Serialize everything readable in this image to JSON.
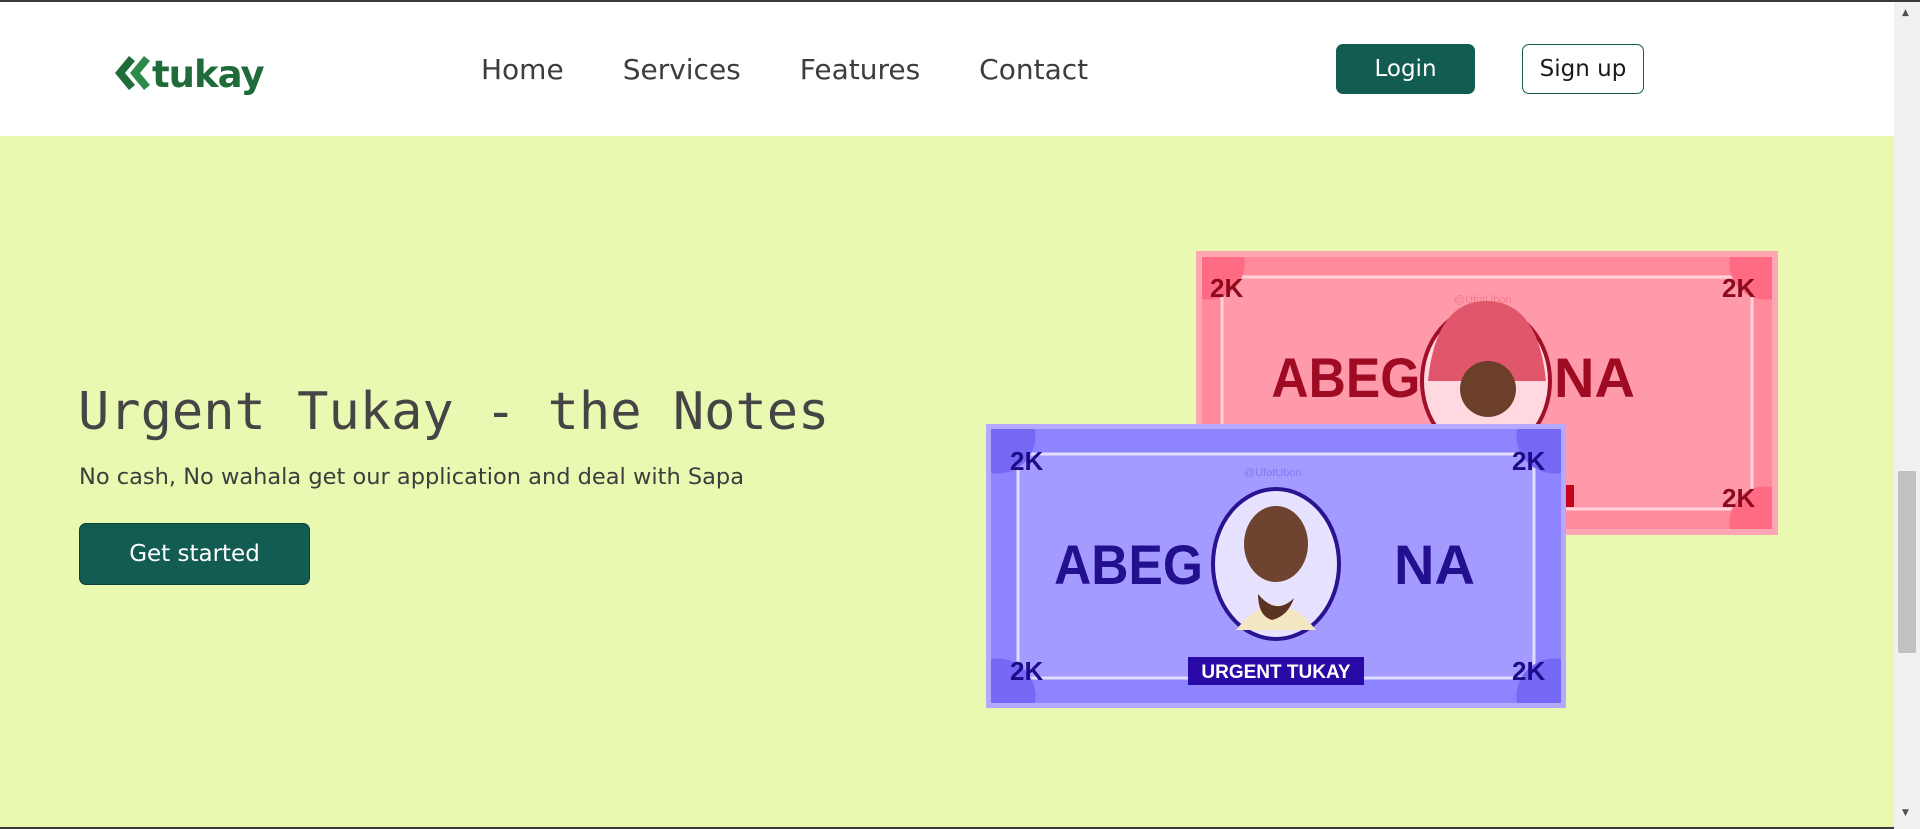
{
  "brand": {
    "logo_text": "tukay",
    "logo_color": "#1f6b3a"
  },
  "nav": {
    "links": [
      "Home",
      "Services",
      "Features",
      "Contact"
    ],
    "login_label": "Login",
    "signup_label": "Sign up"
  },
  "hero": {
    "title": "Urgent Tukay - the Notes",
    "subtitle": "No cash, No wahala get our application and deal with Sapa",
    "cta_label": "Get started"
  },
  "notes": {
    "pink": {
      "denomination": "2K",
      "left_word": "ABEG",
      "right_word": "NA",
      "watermark": "@UfotUbon",
      "color": "#ff8fa0"
    },
    "purple": {
      "denomination": "2K",
      "left_word": "ABEG",
      "right_word": "NA",
      "banner": "URGENT TUKAY",
      "watermark": "@UfotUbon",
      "color": "#9f94ff"
    }
  },
  "colors": {
    "background": "#e9f9b1",
    "primary": "#135c52",
    "text": "#3d3d3d"
  }
}
